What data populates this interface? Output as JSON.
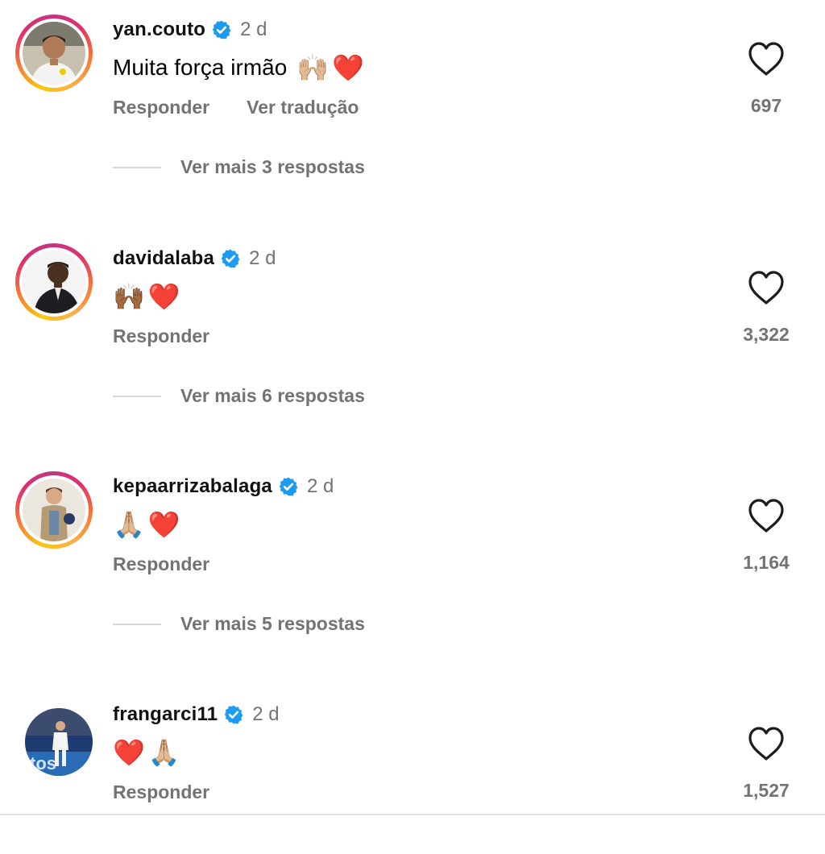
{
  "ui": {
    "accent_ring_colors": [
      "#f9c80e",
      "#f77737",
      "#e1306c",
      "#c13584"
    ],
    "verified_color": "#1d9bf0",
    "muted_text_color": "#737373"
  },
  "comments": [
    {
      "username": "yan.couto",
      "time": "2 d",
      "text": "Muita força irmão",
      "emojis": [
        "🙌🏼",
        "❤️"
      ],
      "reply_label": "Responder",
      "translate_label": "Ver tradução",
      "likes": "697",
      "more_replies": "Ver mais 3 respostas"
    },
    {
      "username": "davidalaba",
      "time": "2 d",
      "emojis": [
        "🙌🏾",
        "❤️"
      ],
      "reply_label": "Responder",
      "likes": "3,322",
      "more_replies": "Ver mais 6 respostas"
    },
    {
      "username": "kepaarrizabalaga",
      "time": "2 d",
      "emojis": [
        "🙏🏼",
        "❤️"
      ],
      "reply_label": "Responder",
      "likes": "1,164",
      "more_replies": "Ver mais 5 respostas"
    },
    {
      "username": "frangarci11",
      "time": "2 d",
      "emojis": [
        "❤️",
        "🙏🏼"
      ],
      "reply_label": "Responder",
      "likes": "1,527"
    }
  ]
}
